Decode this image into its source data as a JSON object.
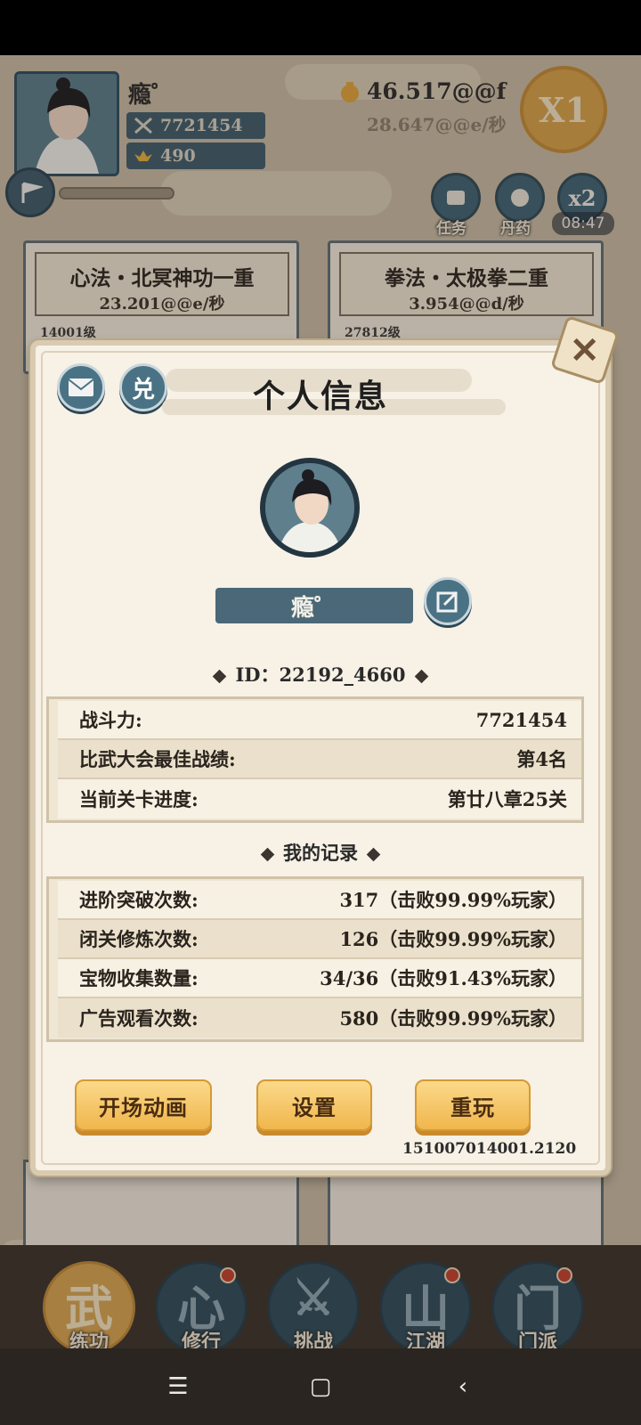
{
  "hud": {
    "player_name": "瘾゜",
    "combat_power": "7721454",
    "ingots": "490",
    "gold": "46.517@@f",
    "gold_rate": "28.647@@e/秒",
    "speed_multiplier": "X1",
    "quest_label": "任务",
    "elixir_label": "丹药",
    "boost_label": "x2",
    "boost_timer": "08:47"
  },
  "skills": [
    {
      "title": "心法・北冥神功一重",
      "rate": "23.201@@e/秒",
      "level": "14001级"
    },
    {
      "title": "拳法・太极拳二重",
      "rate": "3.954@@d/秒",
      "level": "27812级"
    }
  ],
  "dialog": {
    "mail_icon": "envelope-icon",
    "redeem_label": "兑",
    "title": "个人信息",
    "name": "瘾゜",
    "id_text": "ID：22192_4660",
    "stats": [
      {
        "label": "战斗力:",
        "value": "7721454"
      },
      {
        "label": "比武大会最佳战绩:",
        "value": "第4名"
      },
      {
        "label": "当前关卡进度:",
        "value": "第廿八章25关"
      }
    ],
    "records_title": "我的记录",
    "records": [
      {
        "label": "进阶突破次数:",
        "value": "317（击败99.99%玩家）"
      },
      {
        "label": "闭关修炼次数:",
        "value": "126（击败99.99%玩家）"
      },
      {
        "label": "宝物收集数量:",
        "value": "34/36（击败91.43%玩家）"
      },
      {
        "label": "广告观看次数:",
        "value": "580（击败99.99%玩家）"
      }
    ],
    "buttons": {
      "intro": "开场动画",
      "settings": "设置",
      "replay": "重玩"
    },
    "version": "151007014001.2120"
  },
  "nav": [
    {
      "label": "练功",
      "glyph": "武"
    },
    {
      "label": "修行",
      "glyph": "心"
    },
    {
      "label": "挑战",
      "glyph": "⚔"
    },
    {
      "label": "江湖",
      "glyph": "山"
    },
    {
      "label": "门派",
      "glyph": "门"
    }
  ],
  "system_nav": {
    "menu": "☰",
    "home": "▢",
    "back": "‹"
  }
}
